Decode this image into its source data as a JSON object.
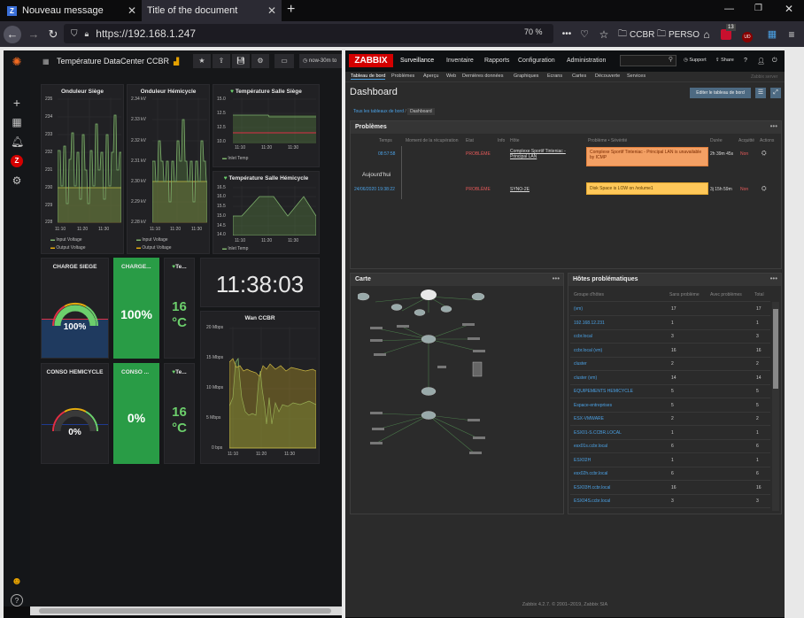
{
  "browser": {
    "tabs": [
      {
        "label": "Nouveau message",
        "icon": "Z"
      },
      {
        "label": "Title of the document",
        "icon": ""
      }
    ],
    "new_tab": "+",
    "url": "https://192.168.1.247",
    "zoom": "70 %",
    "bookmarks": [
      "CCBR",
      "PERSO"
    ],
    "badge_count": "13",
    "ext_badge": "UD"
  },
  "grafana": {
    "dashboard_title": "Température DataCenter CCBR",
    "time_range": "now-30m to",
    "panels": {
      "onduleur_siege": {
        "title": "Onduleur Siège",
        "yticks": [
          "235",
          "234",
          "233",
          "232",
          "231",
          "230",
          "229",
          "228"
        ],
        "xticks": [
          "11:10",
          "11:20",
          "11:30"
        ],
        "legend": [
          "Input Voltage",
          "Output Voltage"
        ]
      },
      "onduleur_hem": {
        "title": "Onduleur Hémicycle",
        "yticks": [
          "2.34 kV",
          "2.33 kV",
          "2.32 kV",
          "2.31 kV",
          "2.30 kV",
          "2.29 kV",
          "2.28 kV"
        ],
        "xticks": [
          "11:10",
          "11:20",
          "11:30"
        ],
        "legend": [
          "Input Voltage",
          "Output Voltage"
        ]
      },
      "temp_siege": {
        "title": "Température Salle Siège",
        "yticks": [
          "15.0",
          "12.5",
          "10.0",
          "17.5",
          "15.0",
          "12.5",
          "10.0"
        ],
        "xticks": [
          "11:10",
          "11:20",
          "11:30"
        ],
        "legend": [
          "Inlet Temp"
        ]
      },
      "temp_hem": {
        "title": "Température Salle Hémicycle",
        "yticks": [
          "16.5",
          "16.0",
          "15.5",
          "15.0",
          "14.5",
          "14.0"
        ],
        "xticks": [
          "11:10",
          "11:20",
          "11:30"
        ],
        "legend": [
          "Inlet Temp"
        ]
      },
      "charge_siege": {
        "title": "CHARGE SIEGE",
        "value": "100%"
      },
      "charge_stat": {
        "title": "CHARGE...",
        "value": "100%"
      },
      "temp1": {
        "title": "Te...",
        "value": "16",
        "unit": "°C"
      },
      "clock": {
        "value": "11:38:03"
      },
      "conso_hem": {
        "title": "CONSO HEMICYCLE",
        "value": "0%"
      },
      "conso_stat": {
        "title": "CONSO ...",
        "value": "0%"
      },
      "temp2": {
        "title": "Te...",
        "value": "16",
        "unit": "°C"
      },
      "wan": {
        "title": "Wan CCBR",
        "yticks": [
          "20 Mbps",
          "15 Mbps",
          "10 Mbps",
          "5 Mbps",
          "0 bps"
        ],
        "xticks": [
          "11:10",
          "11:20",
          "11:30"
        ]
      }
    }
  },
  "zabbix": {
    "logo": "ZABBIX",
    "menu": [
      "Surveillance",
      "Inventaire",
      "Rapports",
      "Configuration",
      "Administration"
    ],
    "support": "Support",
    "share": "Share",
    "help": "?",
    "submenu": [
      "Tableau de bord",
      "Problèmes",
      "Aperçu",
      "Web",
      "Dernières données",
      "Graphiques",
      "Ecrans",
      "Cartes",
      "Découverte",
      "Services"
    ],
    "page_title": "Dashboard",
    "edit_button": "Editer le tableau de bord",
    "breadcrumb": [
      "Tous les tableaux de bord",
      "Dashboard"
    ],
    "server_name": "Zabbix server",
    "problems": {
      "title": "Problèmes",
      "headers": [
        "Temps",
        "Moment de la récupération",
        "Etat",
        "Info",
        "Hôte",
        "Problème • Sévérité",
        "Durée",
        "Acquitté",
        "Actions"
      ],
      "today": "Aujourd'hui",
      "rows": [
        {
          "time": "08:57:58",
          "state": "PROBLÈME",
          "host": "Complexe Sportif Tinteniac - Principal LAN",
          "problem": "Complexe Sportif Tinteniac - Principal LAN is unavailable by ICMP",
          "duration": "2h 39m 45s",
          "ack": "Non"
        },
        {
          "time": "24/06/2020 19:38:22",
          "state": "PROBLÈME",
          "host": "SYNO-2E",
          "problem": "Disk Space is LOW on /volume1",
          "duration": "3j 15h 59m",
          "ack": "Non"
        }
      ]
    },
    "map": {
      "title": "Carte"
    },
    "hosts": {
      "title": "Hôtes problématiques",
      "headers": [
        "Groupe d'hôtes",
        "Sans problème",
        "Avec problèmes",
        "Total"
      ],
      "rows": [
        [
          "(vm)",
          "17",
          "",
          "17"
        ],
        [
          "192.168.12.231",
          "1",
          "",
          "1"
        ],
        [
          "ccbr.local",
          "3",
          "",
          "3"
        ],
        [
          "ccbr.local (vm)",
          "16",
          "",
          "16"
        ],
        [
          "cluster",
          "2",
          "",
          "2"
        ],
        [
          "cluster (vm)",
          "14",
          "",
          "14"
        ],
        [
          "EQUIPEMENTS HEMICYCLE",
          "5",
          "",
          "5"
        ],
        [
          "Espace-entreprises",
          "5",
          "",
          "5"
        ],
        [
          "ESX-VMWARE",
          "2",
          "",
          "2"
        ],
        [
          "ESX01-S.CCBR.LOCAL",
          "1",
          "",
          "1"
        ],
        [
          "esx01s.ccbr.local",
          "6",
          "",
          "6"
        ],
        [
          "ESX02H",
          "1",
          "",
          "1"
        ],
        [
          "esx02h.ccbr.local",
          "6",
          "",
          "6"
        ],
        [
          "ESX03H.ccbr.local",
          "16",
          "",
          "16"
        ],
        [
          "ESX04S.ccbr.local",
          "3",
          "",
          "3"
        ]
      ]
    },
    "footer": "Zabbix 4.2.7. © 2001–2019, Zabbix SIA"
  }
}
